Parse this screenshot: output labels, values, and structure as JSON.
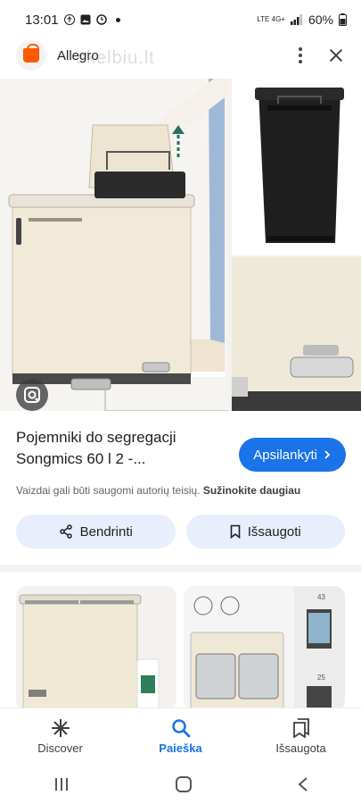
{
  "status_bar": {
    "time": "13:01",
    "network": "LTE 4G+",
    "battery": "60%"
  },
  "header": {
    "site_name": "Allegro",
    "watermark": "skelbiu.lt"
  },
  "result": {
    "title": "Pojemniki do segregacji Songmics 60 l 2 -...",
    "visit_label": "Apsilankyti",
    "copyright_text": "Vaizdai gali būti saugomi autorių teisių.",
    "learn_more": "Sužinokite daugiau"
  },
  "actions": {
    "share_label": "Bendrinti",
    "save_label": "Išsaugoti"
  },
  "bottom_nav": {
    "items": [
      {
        "label": "Discover",
        "icon": "asterisk-icon"
      },
      {
        "label": "Paieška",
        "icon": "search-icon"
      },
      {
        "label": "Išsaugota",
        "icon": "bookmarks-icon"
      }
    ],
    "active": "Paieška"
  },
  "related": {
    "badges": [
      "43",
      "25"
    ]
  },
  "colors": {
    "accent": "#1a73e8",
    "pill_bg": "#e8eefb",
    "brand": "#ff5a00"
  }
}
